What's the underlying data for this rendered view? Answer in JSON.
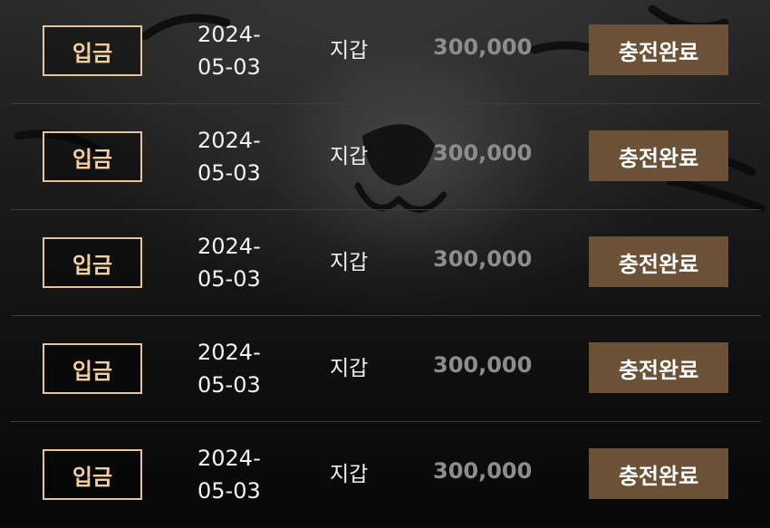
{
  "transactions": [
    {
      "type": "입금",
      "date_line1": "2024-",
      "date_line2": "05-03",
      "wallet": "지갑",
      "amount": "300,000",
      "status": "충전완료"
    },
    {
      "type": "입금",
      "date_line1": "2024-",
      "date_line2": "05-03",
      "wallet": "지갑",
      "amount": "300,000",
      "status": "충전완료"
    },
    {
      "type": "입금",
      "date_line1": "2024-",
      "date_line2": "05-03",
      "wallet": "지갑",
      "amount": "300,000",
      "status": "충전완료"
    },
    {
      "type": "입금",
      "date_line1": "2024-",
      "date_line2": "05-03",
      "wallet": "지갑",
      "amount": "300,000",
      "status": "충전완료"
    },
    {
      "type": "입금",
      "date_line1": "2024-",
      "date_line2": "05-03",
      "wallet": "지갑",
      "amount": "300,000",
      "status": "충전완료"
    }
  ],
  "colors": {
    "badge_border": "#e8c49a",
    "badge_text": "#f2cfa2",
    "status_button_bg": "#6b5236",
    "amount_text": "#8d8d8d",
    "row_divider": "#3e3e3e"
  }
}
